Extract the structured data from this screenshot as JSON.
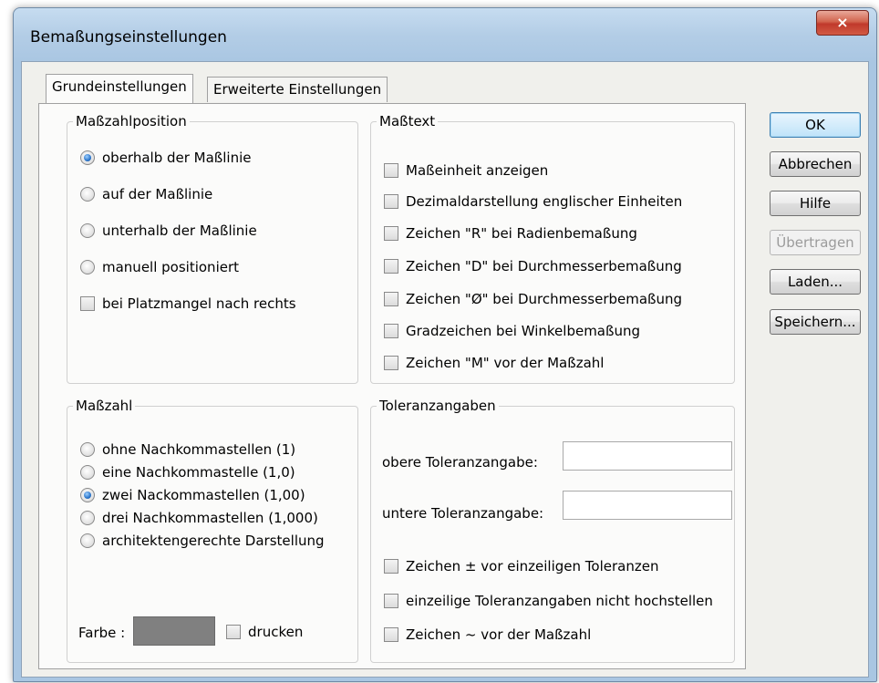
{
  "window": {
    "title": "Bemaßungseinstellungen",
    "close_icon": "×"
  },
  "tabs": [
    {
      "label": "Grundeinstellungen",
      "active": true
    },
    {
      "label": "Erweiterte Einstellungen",
      "active": false
    }
  ],
  "masszahlposition": {
    "legend": "Maßzahlposition",
    "options": [
      {
        "label": "oberhalb der Maßlinie",
        "checked": true
      },
      {
        "label": "auf der Maßlinie",
        "checked": false
      },
      {
        "label": "unterhalb der Maßlinie",
        "checked": false
      },
      {
        "label": "manuell positioniert",
        "checked": false
      }
    ],
    "checkbox_label": "bei Platzmangel nach rechts"
  },
  "masstext": {
    "legend": "Maßtext",
    "checkboxes": [
      "Maßeinheit anzeigen",
      "Dezimaldarstellung englischer Einheiten",
      "Zeichen \"R\" bei Radienbemaßung",
      "Zeichen \"D\" bei Durchmesserbemaßung",
      "Zeichen \"Ø\" bei Durchmesserbemaßung",
      "Gradzeichen bei Winkelbemaßung",
      "Zeichen \"M\" vor der Maßzahl"
    ]
  },
  "masszahl": {
    "legend": "Maßzahl",
    "options": [
      {
        "label": "ohne Nachkommastellen (1)",
        "checked": false
      },
      {
        "label": "eine Nachkommastelle (1,0)",
        "checked": false
      },
      {
        "label": "zwei Nackommastellen (1,00)",
        "checked": true
      },
      {
        "label": "drei Nachkommastellen (1,000)",
        "checked": false
      },
      {
        "label": "architektengerechte Darstellung",
        "checked": false
      }
    ],
    "farbe_label": "Farbe :",
    "farbe_color": "#808080",
    "drucken_label": "drucken"
  },
  "toleranz": {
    "legend": "Toleranzangaben",
    "obere_label": "obere Toleranzangabe:",
    "obere_value": "",
    "untere_label": "untere Toleranzangabe:",
    "untere_value": "",
    "checkboxes": [
      "Zeichen ± vor einzeiligen Toleranzen",
      "einzeilige Toleranzangaben nicht hochstellen",
      "Zeichen ~ vor der Maßzahl"
    ]
  },
  "buttons": {
    "ok": "OK",
    "abbrechen": "Abbrechen",
    "hilfe": "Hilfe",
    "uebertragen": "Übertragen",
    "laden": "Laden...",
    "speichern": "Speichern..."
  }
}
